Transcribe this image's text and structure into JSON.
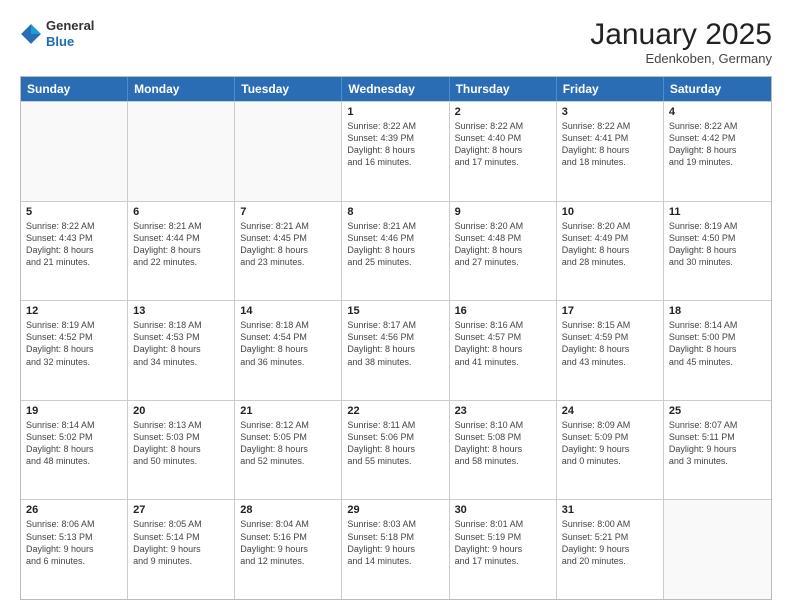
{
  "header": {
    "logo_general": "General",
    "logo_blue": "Blue",
    "month_title": "January 2025",
    "location": "Edenkoben, Germany"
  },
  "weekdays": [
    "Sunday",
    "Monday",
    "Tuesday",
    "Wednesday",
    "Thursday",
    "Friday",
    "Saturday"
  ],
  "weeks": [
    [
      {
        "day": "",
        "info": ""
      },
      {
        "day": "",
        "info": ""
      },
      {
        "day": "",
        "info": ""
      },
      {
        "day": "1",
        "info": "Sunrise: 8:22 AM\nSunset: 4:39 PM\nDaylight: 8 hours\nand 16 minutes."
      },
      {
        "day": "2",
        "info": "Sunrise: 8:22 AM\nSunset: 4:40 PM\nDaylight: 8 hours\nand 17 minutes."
      },
      {
        "day": "3",
        "info": "Sunrise: 8:22 AM\nSunset: 4:41 PM\nDaylight: 8 hours\nand 18 minutes."
      },
      {
        "day": "4",
        "info": "Sunrise: 8:22 AM\nSunset: 4:42 PM\nDaylight: 8 hours\nand 19 minutes."
      }
    ],
    [
      {
        "day": "5",
        "info": "Sunrise: 8:22 AM\nSunset: 4:43 PM\nDaylight: 8 hours\nand 21 minutes."
      },
      {
        "day": "6",
        "info": "Sunrise: 8:21 AM\nSunset: 4:44 PM\nDaylight: 8 hours\nand 22 minutes."
      },
      {
        "day": "7",
        "info": "Sunrise: 8:21 AM\nSunset: 4:45 PM\nDaylight: 8 hours\nand 23 minutes."
      },
      {
        "day": "8",
        "info": "Sunrise: 8:21 AM\nSunset: 4:46 PM\nDaylight: 8 hours\nand 25 minutes."
      },
      {
        "day": "9",
        "info": "Sunrise: 8:20 AM\nSunset: 4:48 PM\nDaylight: 8 hours\nand 27 minutes."
      },
      {
        "day": "10",
        "info": "Sunrise: 8:20 AM\nSunset: 4:49 PM\nDaylight: 8 hours\nand 28 minutes."
      },
      {
        "day": "11",
        "info": "Sunrise: 8:19 AM\nSunset: 4:50 PM\nDaylight: 8 hours\nand 30 minutes."
      }
    ],
    [
      {
        "day": "12",
        "info": "Sunrise: 8:19 AM\nSunset: 4:52 PM\nDaylight: 8 hours\nand 32 minutes."
      },
      {
        "day": "13",
        "info": "Sunrise: 8:18 AM\nSunset: 4:53 PM\nDaylight: 8 hours\nand 34 minutes."
      },
      {
        "day": "14",
        "info": "Sunrise: 8:18 AM\nSunset: 4:54 PM\nDaylight: 8 hours\nand 36 minutes."
      },
      {
        "day": "15",
        "info": "Sunrise: 8:17 AM\nSunset: 4:56 PM\nDaylight: 8 hours\nand 38 minutes."
      },
      {
        "day": "16",
        "info": "Sunrise: 8:16 AM\nSunset: 4:57 PM\nDaylight: 8 hours\nand 41 minutes."
      },
      {
        "day": "17",
        "info": "Sunrise: 8:15 AM\nSunset: 4:59 PM\nDaylight: 8 hours\nand 43 minutes."
      },
      {
        "day": "18",
        "info": "Sunrise: 8:14 AM\nSunset: 5:00 PM\nDaylight: 8 hours\nand 45 minutes."
      }
    ],
    [
      {
        "day": "19",
        "info": "Sunrise: 8:14 AM\nSunset: 5:02 PM\nDaylight: 8 hours\nand 48 minutes."
      },
      {
        "day": "20",
        "info": "Sunrise: 8:13 AM\nSunset: 5:03 PM\nDaylight: 8 hours\nand 50 minutes."
      },
      {
        "day": "21",
        "info": "Sunrise: 8:12 AM\nSunset: 5:05 PM\nDaylight: 8 hours\nand 52 minutes."
      },
      {
        "day": "22",
        "info": "Sunrise: 8:11 AM\nSunset: 5:06 PM\nDaylight: 8 hours\nand 55 minutes."
      },
      {
        "day": "23",
        "info": "Sunrise: 8:10 AM\nSunset: 5:08 PM\nDaylight: 8 hours\nand 58 minutes."
      },
      {
        "day": "24",
        "info": "Sunrise: 8:09 AM\nSunset: 5:09 PM\nDaylight: 9 hours\nand 0 minutes."
      },
      {
        "day": "25",
        "info": "Sunrise: 8:07 AM\nSunset: 5:11 PM\nDaylight: 9 hours\nand 3 minutes."
      }
    ],
    [
      {
        "day": "26",
        "info": "Sunrise: 8:06 AM\nSunset: 5:13 PM\nDaylight: 9 hours\nand 6 minutes."
      },
      {
        "day": "27",
        "info": "Sunrise: 8:05 AM\nSunset: 5:14 PM\nDaylight: 9 hours\nand 9 minutes."
      },
      {
        "day": "28",
        "info": "Sunrise: 8:04 AM\nSunset: 5:16 PM\nDaylight: 9 hours\nand 12 minutes."
      },
      {
        "day": "29",
        "info": "Sunrise: 8:03 AM\nSunset: 5:18 PM\nDaylight: 9 hours\nand 14 minutes."
      },
      {
        "day": "30",
        "info": "Sunrise: 8:01 AM\nSunset: 5:19 PM\nDaylight: 9 hours\nand 17 minutes."
      },
      {
        "day": "31",
        "info": "Sunrise: 8:00 AM\nSunset: 5:21 PM\nDaylight: 9 hours\nand 20 minutes."
      },
      {
        "day": "",
        "info": ""
      }
    ]
  ]
}
